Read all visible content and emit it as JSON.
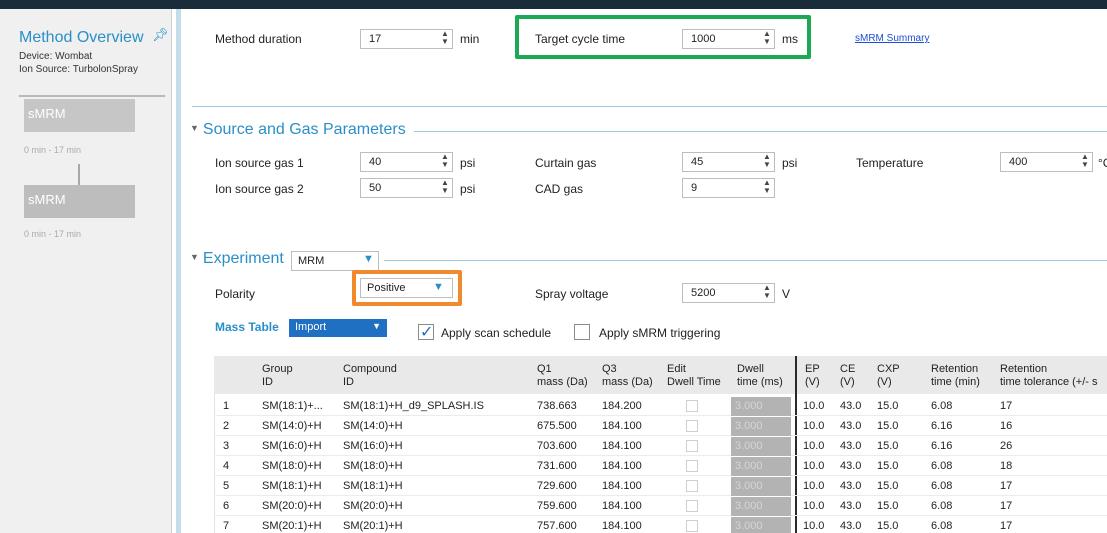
{
  "sidebar": {
    "title": "Method Overview",
    "device": "Device:  Wombat",
    "ion_source": "Ion Source:  TurbolonSpray",
    "cards": [
      {
        "label": "sMRM",
        "time": "0 min  -  17 min"
      },
      {
        "label": "sMRM",
        "time": "0 min  -  17 min"
      }
    ]
  },
  "method": {
    "duration_label": "Method duration",
    "duration_value": "17",
    "duration_unit": "min",
    "cycle_label": "Target cycle time",
    "cycle_value": "1000",
    "cycle_unit": "ms",
    "summary_link": "sMRM Summary"
  },
  "source_gas": {
    "title": "Source and Gas Parameters",
    "ion_gas1_label": "Ion source gas 1",
    "ion_gas1_value": "40",
    "ion_gas2_label": "Ion source gas 2",
    "ion_gas2_value": "50",
    "curtain_label": "Curtain gas",
    "curtain_value": "45",
    "cad_label": "CAD gas",
    "cad_value": "9",
    "temp_label": "Temperature",
    "temp_value": "400",
    "temp_unit": "°C",
    "psi": "psi"
  },
  "experiment": {
    "title": "Experiment",
    "type_value": "MRM",
    "polarity_label": "Polarity",
    "polarity_value": "Positive",
    "spray_label": "Spray voltage",
    "spray_value": "5200",
    "spray_unit": "V"
  },
  "mass_table": {
    "label": "Mass Table",
    "import_label": "Import",
    "apply_schedule_label": "Apply scan schedule",
    "apply_schedule_checked": true,
    "apply_smrm_label": "Apply sMRM triggering",
    "apply_smrm_checked": false,
    "headers": {
      "group": "Group\nID",
      "compound": "Compound\nID",
      "q1": "Q1\nmass (Da)",
      "q3": "Q3\nmass (Da)",
      "edit": "Edit\nDwell Time",
      "dwell": "Dwell\ntime (ms)",
      "ep": "EP\n(V)",
      "ce": "CE\n(V)",
      "cxp": "CXP\n(V)",
      "rt": "Retention\ntime (min)",
      "rtt": "Retention\ntime tolerance (+/- s"
    },
    "rows": [
      {
        "n": "1",
        "group": "SM(18:1)+...",
        "compound": "SM(18:1)+H_d9_SPLASH.IS",
        "q1": "738.663",
        "q3": "184.200",
        "dwell": "3.000",
        "ep": "10.0",
        "ce": "43.0",
        "cxp": "15.0",
        "rt": "6.08",
        "rtt": "17"
      },
      {
        "n": "2",
        "group": "SM(14:0)+H",
        "compound": "SM(14:0)+H",
        "q1": "675.500",
        "q3": "184.100",
        "dwell": "3.000",
        "ep": "10.0",
        "ce": "43.0",
        "cxp": "15.0",
        "rt": "6.16",
        "rtt": "16"
      },
      {
        "n": "3",
        "group": "SM(16:0)+H",
        "compound": "SM(16:0)+H",
        "q1": "703.600",
        "q3": "184.100",
        "dwell": "3.000",
        "ep": "10.0",
        "ce": "43.0",
        "cxp": "15.0",
        "rt": "6.16",
        "rtt": "26"
      },
      {
        "n": "4",
        "group": "SM(18:0)+H",
        "compound": "SM(18:0)+H",
        "q1": "731.600",
        "q3": "184.100",
        "dwell": "3.000",
        "ep": "10.0",
        "ce": "43.0",
        "cxp": "15.0",
        "rt": "6.08",
        "rtt": "18"
      },
      {
        "n": "5",
        "group": "SM(18:1)+H",
        "compound": "SM(18:1)+H",
        "q1": "729.600",
        "q3": "184.100",
        "dwell": "3.000",
        "ep": "10.0",
        "ce": "43.0",
        "cxp": "15.0",
        "rt": "6.08",
        "rtt": "17"
      },
      {
        "n": "6",
        "group": "SM(20:0)+H",
        "compound": "SM(20:0)+H",
        "q1": "759.600",
        "q3": "184.100",
        "dwell": "3.000",
        "ep": "10.0",
        "ce": "43.0",
        "cxp": "15.0",
        "rt": "6.08",
        "rtt": "17"
      },
      {
        "n": "7",
        "group": "SM(20:1)+H",
        "compound": "SM(20:1)+H",
        "q1": "757.600",
        "q3": "184.100",
        "dwell": "3.000",
        "ep": "10.0",
        "ce": "43.0",
        "cxp": "15.0",
        "rt": "6.08",
        "rtt": "17"
      }
    ]
  },
  "colors": {
    "accent": "#2a8fc8",
    "highlight_green": "#1da854",
    "highlight_orange": "#f08a2c",
    "import_button": "#1f6fc2"
  }
}
